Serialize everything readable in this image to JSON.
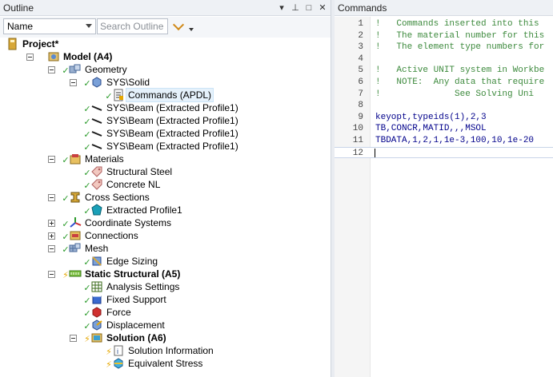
{
  "outline": {
    "title": "Outline",
    "header_icons": [
      "dropdown-arrow-icon",
      "pin-icon",
      "maximize-icon",
      "close-icon"
    ],
    "header_glyphs": [
      "▾",
      "⊥",
      "□",
      "✕"
    ],
    "name_combo": "Name",
    "search_placeholder": "Search Outline",
    "tree": [
      {
        "id": "project",
        "label": "Project*",
        "bold": true,
        "icon": "project-icon",
        "status": ""
      },
      {
        "id": "model",
        "label": "Model (A4)",
        "bold": true,
        "icon": "model-icon",
        "status": ""
      },
      {
        "id": "geometry",
        "label": "Geometry",
        "icon": "geometry-icon",
        "status": "check"
      },
      {
        "id": "sys-solid",
        "label": "SYS\\Solid",
        "icon": "solid-body-icon",
        "status": "check"
      },
      {
        "id": "commands-apdl",
        "label": "Commands (APDL)",
        "icon": "commands-icon",
        "status": "check",
        "selected": true
      },
      {
        "id": "beam1",
        "label": "SYS\\Beam (Extracted Profile1)",
        "icon": "line-body-icon",
        "status": "check"
      },
      {
        "id": "beam2",
        "label": "SYS\\Beam (Extracted Profile1)",
        "icon": "line-body-icon",
        "status": "check"
      },
      {
        "id": "beam3",
        "label": "SYS\\Beam (Extracted Profile1)",
        "icon": "line-body-icon",
        "status": "check"
      },
      {
        "id": "beam4",
        "label": "SYS\\Beam (Extracted Profile1)",
        "icon": "line-body-icon",
        "status": "check"
      },
      {
        "id": "materials",
        "label": "Materials",
        "icon": "materials-icon",
        "status": "check"
      },
      {
        "id": "structural-steel",
        "label": "Structural Steel",
        "icon": "material-tag-icon",
        "status": "check"
      },
      {
        "id": "concrete-nl",
        "label": "Concrete NL",
        "icon": "material-tag-icon",
        "status": "check"
      },
      {
        "id": "cross-sections",
        "label": "Cross Sections",
        "icon": "cross-section-icon",
        "status": "check"
      },
      {
        "id": "extracted-profile1",
        "label": "Extracted Profile1",
        "icon": "profile-icon",
        "status": "check"
      },
      {
        "id": "coordinate-systems",
        "label": "Coordinate Systems",
        "icon": "coordinate-systems-icon",
        "status": "check"
      },
      {
        "id": "connections",
        "label": "Connections",
        "icon": "connections-icon",
        "status": "check"
      },
      {
        "id": "mesh",
        "label": "Mesh",
        "icon": "mesh-icon",
        "status": "check"
      },
      {
        "id": "edge-sizing",
        "label": "Edge Sizing",
        "icon": "edge-sizing-icon",
        "status": "check"
      },
      {
        "id": "static-structural",
        "label": "Static Structural (A5)",
        "bold": true,
        "icon": "static-structural-icon",
        "status": "bolt"
      },
      {
        "id": "analysis-settings",
        "label": "Analysis Settings",
        "icon": "analysis-settings-icon",
        "status": "check"
      },
      {
        "id": "fixed-support",
        "label": "Fixed Support",
        "icon": "fixed-support-icon",
        "status": "check"
      },
      {
        "id": "force",
        "label": "Force",
        "icon": "force-icon",
        "status": "check"
      },
      {
        "id": "displacement",
        "label": "Displacement",
        "icon": "displacement-icon",
        "status": "check"
      },
      {
        "id": "solution",
        "label": "Solution (A6)",
        "bold": true,
        "icon": "solution-icon",
        "status": "bolt"
      },
      {
        "id": "solution-information",
        "label": "Solution Information",
        "icon": "solution-information-icon",
        "status": "bolt"
      },
      {
        "id": "equivalent-stress",
        "label": "Equivalent Stress",
        "icon": "equivalent-stress-icon",
        "status": "bolt"
      }
    ]
  },
  "commands": {
    "title": "Commands",
    "lines": [
      {
        "n": "1",
        "text": "!   Commands inserted into this",
        "type": "comment"
      },
      {
        "n": "2",
        "text": "!   The material number for this",
        "type": "comment"
      },
      {
        "n": "3",
        "text": "!   The element type numbers for",
        "type": "comment"
      },
      {
        "n": "4",
        "text": "",
        "type": "blank"
      },
      {
        "n": "5",
        "text": "!   Active UNIT system in Workbe",
        "type": "comment"
      },
      {
        "n": "6",
        "text": "!   NOTE:  Any data that require",
        "type": "comment"
      },
      {
        "n": "7",
        "text": "!              See Solving Uni",
        "type": "comment"
      },
      {
        "n": "8",
        "text": "",
        "type": "blank"
      },
      {
        "n": "9",
        "text": "keyopt,typeids(1),2,3",
        "type": "code"
      },
      {
        "n": "10",
        "text": "TB,CONCR,MATID,,,MSOL",
        "type": "code"
      },
      {
        "n": "11",
        "text": "TBDATA,1,2,1,1e-3,100,10,1e-20",
        "type": "code"
      },
      {
        "n": "12",
        "text": "",
        "type": "current"
      }
    ]
  },
  "colors": {
    "check": "#2a9a2a",
    "bolt": "#e6a700",
    "comment": "#3d8a3d",
    "code": "#00008b"
  }
}
